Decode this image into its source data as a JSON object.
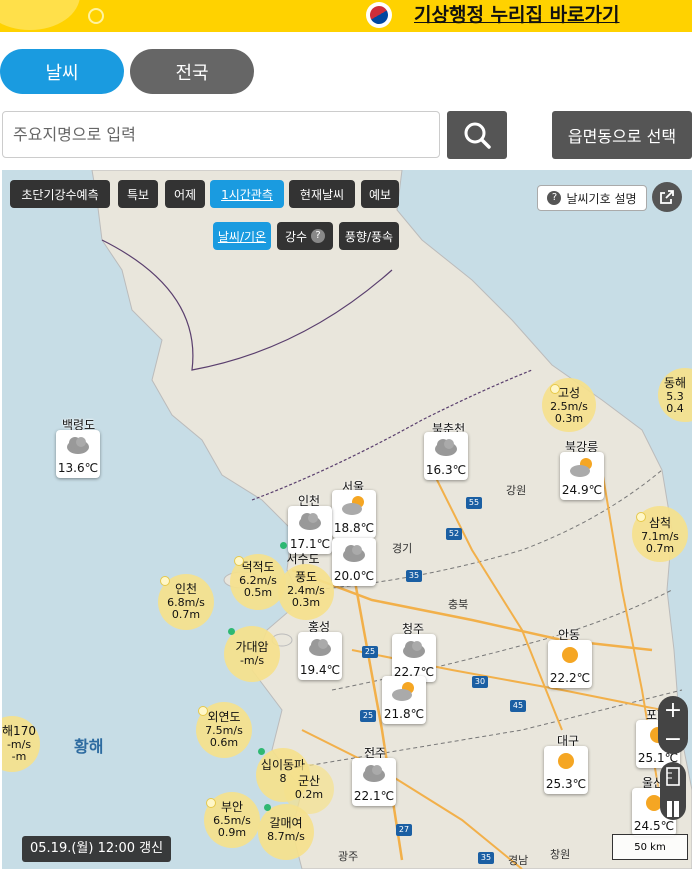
{
  "header": {
    "gov_link": "기상행정 누리집 바로가기"
  },
  "tabs": [
    {
      "label": "날씨"
    },
    {
      "label": "전국"
    }
  ],
  "search": {
    "placeholder": "주요지명으로 입력",
    "select_label": "읍면동으로 선택"
  },
  "map_tabs": [
    "초단기강수예측",
    "특보",
    "어제",
    "1시간관측",
    "현재날씨",
    "예보"
  ],
  "sub_tabs": [
    "날씨/기온",
    "강수",
    "풍향/풍속"
  ],
  "legend_label": "날씨기호 설명",
  "timestamp": "05.19.(월) 12:00 갱신",
  "scale_label": "50 km",
  "sea_label": "황해",
  "stations": [
    {
      "name": "백령도",
      "temp": "13.6℃",
      "icon": "cloud-icon"
    },
    {
      "name": "북춘천",
      "temp": "16.3℃",
      "icon": "cloud-icon"
    },
    {
      "name": "북강릉",
      "temp": "24.9℃",
      "icon": "partly-sunny-icon"
    },
    {
      "name": "서울",
      "temp": "18.8℃",
      "icon": "partly-sunny-icon"
    },
    {
      "name": "인천",
      "temp": "17.1℃",
      "icon": "cloud-icon"
    },
    {
      "name": "",
      "temp": "20.0℃",
      "icon": "cloud-icon"
    },
    {
      "name": "홍성",
      "temp": "19.4℃",
      "icon": "cloud-icon"
    },
    {
      "name": "청주",
      "temp": "22.7℃",
      "icon": "cloud-icon"
    },
    {
      "name": "",
      "temp": "21.8℃",
      "icon": "partly-sunny-icon"
    },
    {
      "name": "안동",
      "temp": "22.2℃",
      "icon": "sun-icon"
    },
    {
      "name": "전주",
      "temp": "22.1℃",
      "icon": "cloud-icon"
    },
    {
      "name": "대구",
      "temp": "25.3℃",
      "icon": "sun-icon"
    },
    {
      "name": "포항",
      "temp": "25.1℃",
      "icon": "sun-icon"
    },
    {
      "name": "울산",
      "temp": "24.5℃",
      "icon": "sun-icon"
    }
  ],
  "wind": [
    {
      "name": "고성",
      "speed": "2.5m/s",
      "rain": "0.3m"
    },
    {
      "name": "동해",
      "speed": "5.3",
      "rain": "0.4"
    },
    {
      "name": "삼척",
      "speed": "7.1m/s",
      "rain": "0.7m"
    },
    {
      "name": "덕적도",
      "speed": "6.2m/s",
      "rain": "0.5m"
    },
    {
      "name": "서수도",
      "speed": "",
      "rain": ""
    },
    {
      "name": "풍도",
      "speed": "2.4m/s",
      "rain": "0.3m"
    },
    {
      "name": "인천",
      "speed": "6.8m/s",
      "rain": "0.7m"
    },
    {
      "name": "가대암",
      "speed": "-m/s",
      "rain": ""
    },
    {
      "name": "외연도",
      "speed": "7.5m/s",
      "rain": "0.6m"
    },
    {
      "name": "해170",
      "speed": "-m/s",
      "rain": "-m"
    },
    {
      "name": "십이동파",
      "speed": "8",
      "rain": ""
    },
    {
      "name": "군산",
      "speed": "0.2m",
      "rain": ""
    },
    {
      "name": "부안",
      "speed": "6.5m/s",
      "rain": "0.9m"
    },
    {
      "name": "갈매여",
      "speed": "8.7m/s",
      "rain": ""
    }
  ],
  "regions": [
    "강원",
    "경기",
    "충북",
    "경남",
    "광주",
    "창원"
  ]
}
